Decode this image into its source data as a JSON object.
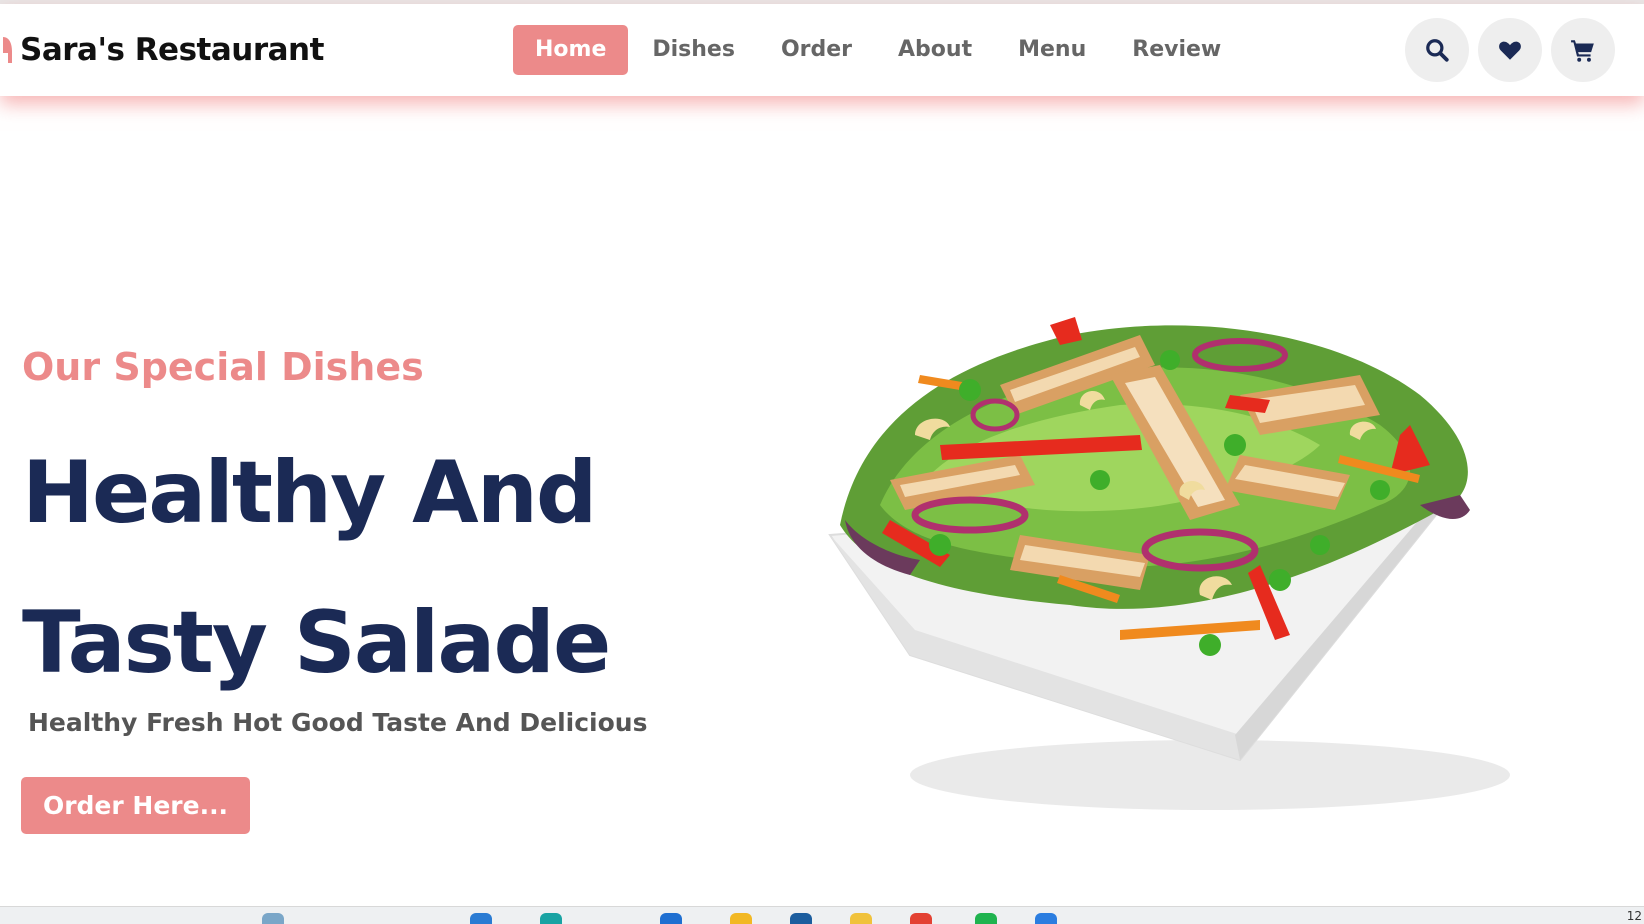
{
  "brand": {
    "name": "Sara's Restaurant",
    "accent": "#ec8a8a",
    "navy": "#1b2a55"
  },
  "nav": {
    "items": [
      {
        "label": "Home",
        "active": true
      },
      {
        "label": "Dishes",
        "active": false
      },
      {
        "label": "Order",
        "active": false
      },
      {
        "label": "About",
        "active": false
      },
      {
        "label": "Menu",
        "active": false
      },
      {
        "label": "Review",
        "active": false
      }
    ]
  },
  "header_icons": [
    "search-icon",
    "heart-icon",
    "cart-icon"
  ],
  "hero": {
    "subtitle": "Our Special Dishes",
    "title_line1": "Healthy And",
    "title_line2": "Tasty Salade",
    "description": "Healthy Fresh Hot Good Taste And Delicious",
    "button_label": "Order Here..."
  },
  "taskbar": {
    "clock": "12"
  }
}
